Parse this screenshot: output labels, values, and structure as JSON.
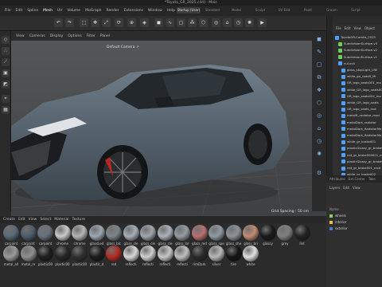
{
  "window": {
    "title": "*Toyota_GR_2025.c4d] - Main"
  },
  "main_menu": [
    "File",
    "Edit",
    "Spline",
    "Mesh",
    "UV",
    "Volume",
    "MoGraph",
    "Render",
    "Extensions",
    "Window",
    "Help"
  ],
  "main_menu_active": "Mesh",
  "layout_tabs": [
    "Startup (User)",
    "Standard",
    "Model",
    "Sculpt",
    "UV Edit",
    "Paint",
    "Groom",
    "Script"
  ],
  "viewport": {
    "menu": [
      "View",
      "Cameras",
      "Display",
      "Options",
      "Filter",
      "Panel"
    ],
    "camera_label": "Default Camera ↗︎",
    "grid_spacing": "Grid Spacing : 50 cm"
  },
  "toolbar_icons": [
    "undo-icon",
    "redo-icon",
    "select-icon",
    "move-icon",
    "scale-icon",
    "rotate-icon",
    "axis-icon",
    "object-icon",
    "cube-icon",
    "spline-icon",
    "subdivision-icon",
    "array-icon",
    "deformer-icon",
    "field-icon",
    "scene-icon",
    "camera-icon",
    "light-icon",
    "render-icon"
  ],
  "object_panel": {
    "menu": [
      "File",
      "Edit",
      "View",
      "Object"
    ],
    "objects": [
      {
        "name": "ToyotaGR-Corolla_2025",
        "color": "#4da3ff",
        "indent": 0
      },
      {
        "name": "SubdivisionSurface.v3",
        "color": "#6fcf5a",
        "indent": 1
      },
      {
        "name": "SubdivisionSurface.v2",
        "color": "#6fcf5a",
        "indent": 1
      },
      {
        "name": "SubdivisionSurface.v1",
        "color": "#6fcf5a",
        "indent": 1
      },
      {
        "name": "nuLuv0",
        "color": "#4da3ff",
        "indent": 1
      },
      {
        "name": "glass_stopLight_LRE",
        "color": "#4da3ff",
        "indent": 2
      },
      {
        "name": "white_gu_rodoR_Mi",
        "color": "#4da3ff",
        "indent": 2
      },
      {
        "name": "GR_logo_seats001_mo",
        "color": "#4da3ff",
        "indent": 2
      },
      {
        "name": "white_GR_logo_seats001",
        "color": "#4da3ff",
        "indent": 2
      },
      {
        "name": "GR_logo_seats002_mo",
        "color": "#4da3ff",
        "indent": 2
      },
      {
        "name": "white_GR_logo_seats",
        "color": "#4da3ff",
        "indent": 2
      },
      {
        "name": "GR_logo_seats_mol",
        "color": "#4da3ff",
        "indent": 2
      },
      {
        "name": "metalR_radiator_mod",
        "color": "#4da3ff",
        "indent": 2
      },
      {
        "name": "metalDark_radiator",
        "color": "#4da3ff",
        "indent": 2
      },
      {
        "name": "metalDark_RadiatorMe",
        "color": "#4da3ff",
        "indent": 2
      },
      {
        "name": "metalDark_RadiatorMe",
        "color": "#4da3ff",
        "indent": 2
      },
      {
        "name": "white_gr_brake001",
        "color": "#4da3ff",
        "indent": 2
      },
      {
        "name": "plasticGlossy_gr_brake0",
        "color": "#4da3ff",
        "indent": 2
      },
      {
        "name": "red_gr_brake000001_mo",
        "color": "#4da3ff",
        "indent": 2
      },
      {
        "name": "plasticGlossy_gr_brake0",
        "color": "#4da3ff",
        "indent": 2
      },
      {
        "name": "red_gr_brake001_mod",
        "color": "#4da3ff",
        "indent": 2
      },
      {
        "name": "white_gr_brake002",
        "color": "#4da3ff",
        "indent": 2
      }
    ]
  },
  "attributes_tabs": [
    "Attributes",
    "Ext.Center",
    "Take"
  ],
  "layers": {
    "menu": [
      "Layers",
      "Edit",
      "View"
    ],
    "header": "Name",
    "items": [
      {
        "name": "wheels",
        "color": "#8fd14f"
      },
      {
        "name": "interior",
        "color": "#e9c23a"
      },
      {
        "name": "exterior",
        "color": "#3a7fd4"
      }
    ]
  },
  "material_tabs": [
    "Create",
    "Edit",
    "View",
    "Select",
    "Material",
    "Texture"
  ],
  "materials": [
    {
      "name": "carpaint",
      "color": "#5a6a78"
    },
    {
      "name": "carpaint",
      "color": "#4e5d6b"
    },
    {
      "name": "carpaint",
      "color": "#66717c"
    },
    {
      "name": "chrome",
      "color": "#c9c9c9"
    },
    {
      "name": "chrome",
      "color": "#b5b5b5"
    },
    {
      "name": "glassLed",
      "color": "#9aa6b0"
    },
    {
      "name": "glass_blc",
      "color": "#7b858c"
    },
    {
      "name": "glass_cle",
      "color": "#a4adb5"
    },
    {
      "name": "glass_cle",
      "color": "#9ea6ad"
    },
    {
      "name": "glass_cle",
      "color": "#a8b0b8"
    },
    {
      "name": "glass_lor",
      "color": "#939ba2"
    },
    {
      "name": "glass_red",
      "color": "#b87070"
    },
    {
      "name": "glass_spe",
      "color": "#8f9aa3"
    },
    {
      "name": "glass_she",
      "color": "#8b9399"
    },
    {
      "name": "glass_bri",
      "color": "#c28b72"
    },
    {
      "name": "glossy",
      "color": "#1a1a1a"
    },
    {
      "name": "grey",
      "color": "#808080"
    },
    {
      "name": "lint",
      "color": "#222222"
    },
    {
      "name": "metal_all",
      "color": "#9a9a9a"
    },
    {
      "name": "metal_re",
      "color": "#8e8e8e"
    },
    {
      "name": "plastic00",
      "color": "#1e1e1e"
    },
    {
      "name": "plastic00",
      "color": "#262626"
    },
    {
      "name": "plastic00",
      "color": "#303030"
    },
    {
      "name": "plastic_d",
      "color": "#1b1b1b"
    },
    {
      "name": "red",
      "color": "#b22a22"
    },
    {
      "name": "reflecti",
      "color": "#d8d8d8"
    },
    {
      "name": "reflecti",
      "color": "#cfcfcf"
    },
    {
      "name": "reflecti",
      "color": "#c8c8c8"
    },
    {
      "name": "reflecti",
      "color": "#bfbfbf"
    },
    {
      "name": "rimDark",
      "color": "#2a2a2a"
    },
    {
      "name": "silver",
      "color": "#b8b8b8"
    },
    {
      "name": "tire",
      "color": "#151515"
    },
    {
      "name": "white",
      "color": "#e0e0e0"
    }
  ]
}
